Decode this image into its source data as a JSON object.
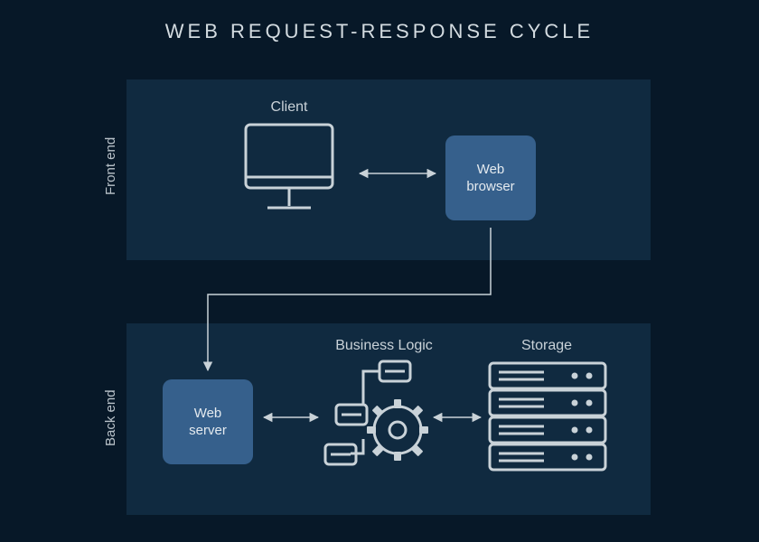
{
  "title": "WEB REQUEST-RESPONSE CYCLE",
  "sections": {
    "front": "Front end",
    "back": "Back end"
  },
  "nodes": {
    "client": "Client",
    "browser_line1": "Web",
    "browser_line2": "browser",
    "server_line1": "Web",
    "server_line2": "server",
    "logic": "Business Logic",
    "storage": "Storage"
  }
}
